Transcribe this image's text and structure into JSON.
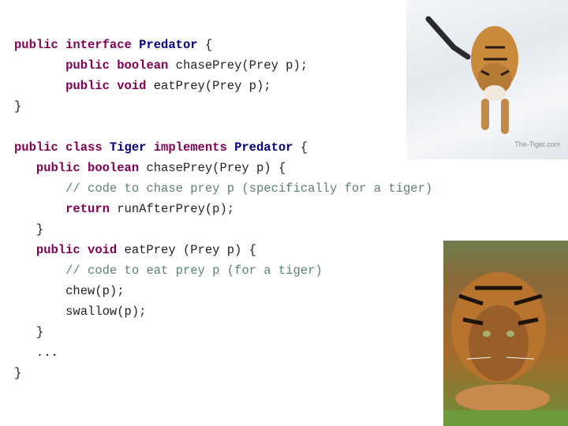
{
  "code": {
    "lines": [
      [
        {
          "t": "public interface ",
          "c": "kw"
        },
        {
          "t": "Predator",
          "c": "ty"
        },
        {
          "t": " {",
          "c": "pl"
        }
      ],
      [
        {
          "t": "       ",
          "c": "pl"
        },
        {
          "t": "public boolean ",
          "c": "kw"
        },
        {
          "t": "chasePrey(Prey p);",
          "c": "pl"
        }
      ],
      [
        {
          "t": "       ",
          "c": "pl"
        },
        {
          "t": "public void ",
          "c": "kw"
        },
        {
          "t": "eatPrey(Prey p);",
          "c": "pl"
        }
      ],
      [
        {
          "t": "}",
          "c": "pl"
        }
      ],
      [
        {
          "t": "",
          "c": "pl"
        }
      ],
      [
        {
          "t": "public class ",
          "c": "kw"
        },
        {
          "t": "Tiger ",
          "c": "ty"
        },
        {
          "t": "implements ",
          "c": "kw"
        },
        {
          "t": "Predator",
          "c": "ty"
        },
        {
          "t": " {",
          "c": "pl"
        }
      ],
      [
        {
          "t": "   ",
          "c": "pl"
        },
        {
          "t": "public boolean ",
          "c": "kw"
        },
        {
          "t": "chasePrey(Prey p) {",
          "c": "pl"
        }
      ],
      [
        {
          "t": "       ",
          "c": "pl"
        },
        {
          "t": "// code to chase prey p (specifically for a tiger)",
          "c": "cm"
        }
      ],
      [
        {
          "t": "       ",
          "c": "pl"
        },
        {
          "t": "return ",
          "c": "kw"
        },
        {
          "t": "runAfterPrey(p);",
          "c": "pl"
        }
      ],
      [
        {
          "t": "   }",
          "c": "pl"
        }
      ],
      [
        {
          "t": "   ",
          "c": "pl"
        },
        {
          "t": "public void ",
          "c": "kw"
        },
        {
          "t": "eatPrey (Prey p) {",
          "c": "pl"
        }
      ],
      [
        {
          "t": "       ",
          "c": "pl"
        },
        {
          "t": "// code to eat prey p (for a tiger)",
          "c": "cm"
        }
      ],
      [
        {
          "t": "       chew(p);",
          "c": "pl"
        }
      ],
      [
        {
          "t": "       swallow(p);",
          "c": "pl"
        }
      ],
      [
        {
          "t": "   }",
          "c": "pl"
        }
      ],
      [
        {
          "t": "   ...",
          "c": "pl"
        }
      ],
      [
        {
          "t": "}",
          "c": "pl"
        }
      ]
    ]
  },
  "images": {
    "top": {
      "alt": "Tiger running in snow",
      "watermark": "The-Tiger.com"
    },
    "bottom": {
      "alt": "Tiger crouching on grass"
    }
  },
  "colors": {
    "keyword": "#7f0055",
    "type": "#000080",
    "comment": "#5f7f6f"
  }
}
